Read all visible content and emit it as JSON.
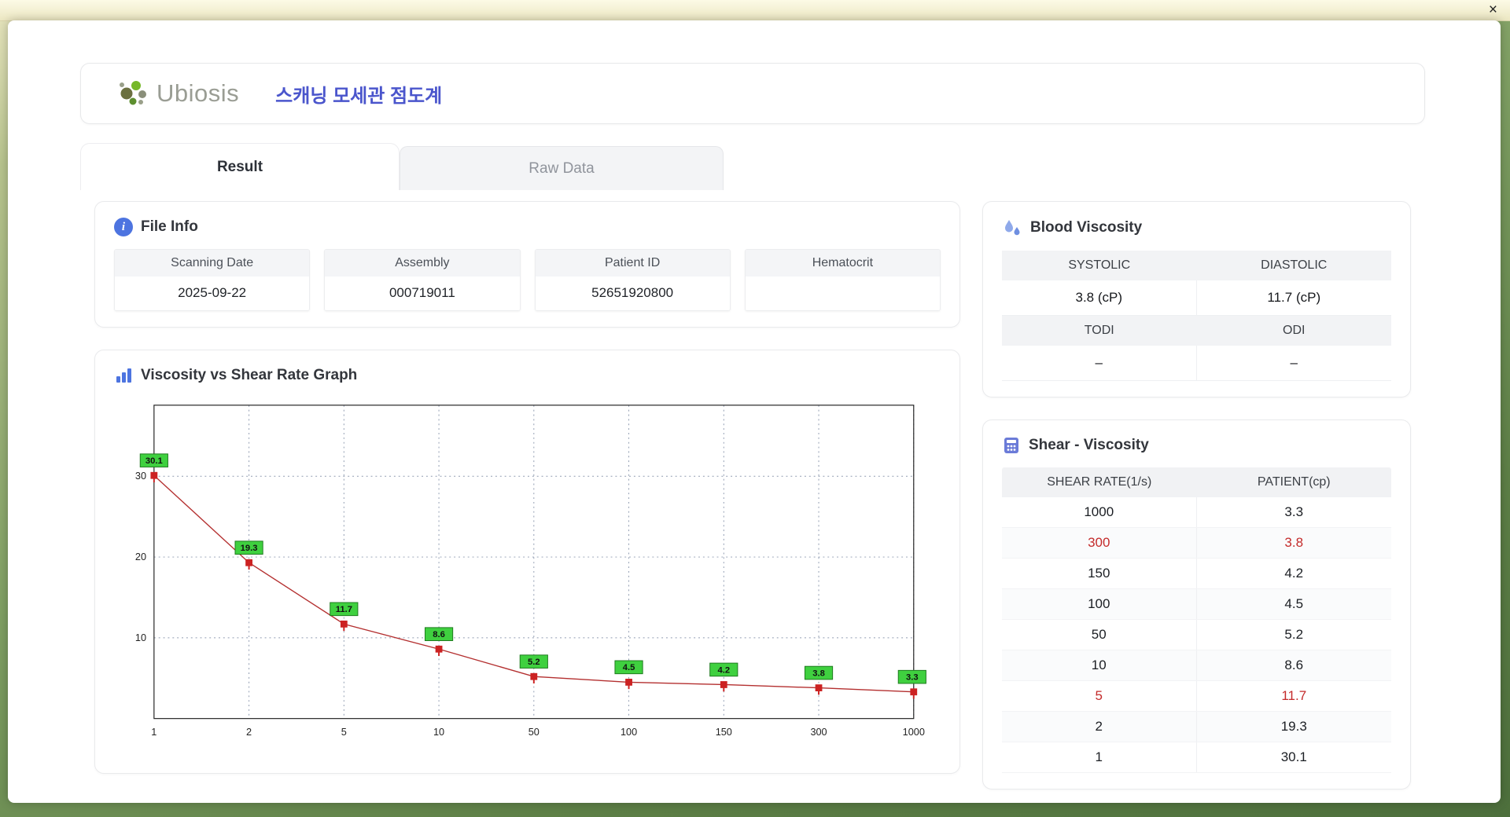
{
  "window": {
    "close_label": "×"
  },
  "header": {
    "brand": "Ubiosis",
    "title": "스캐닝 모세관 점도계"
  },
  "tabs": [
    {
      "label": "Result",
      "active": true
    },
    {
      "label": "Raw Data",
      "active": false
    }
  ],
  "file_info": {
    "title": "File Info",
    "fields": [
      {
        "label": "Scanning Date",
        "value": "2025-09-22"
      },
      {
        "label": "Assembly",
        "value": "000719011"
      },
      {
        "label": "Patient ID",
        "value": "52651920800"
      },
      {
        "label": "Hematocrit",
        "value": ""
      }
    ]
  },
  "blood_viscosity": {
    "title": "Blood Viscosity",
    "cells": [
      {
        "label": "SYSTOLIC",
        "value": "3.8 (cP)"
      },
      {
        "label": "DIASTOLIC",
        "value": "11.7 (cP)"
      },
      {
        "label": "TODI",
        "value": "–"
      },
      {
        "label": "ODI",
        "value": "–"
      }
    ]
  },
  "graph": {
    "title": "Viscosity vs Shear Rate Graph"
  },
  "chart_data": {
    "type": "line",
    "title": "Viscosity vs Shear Rate Graph",
    "x": [
      1,
      2,
      5,
      10,
      50,
      100,
      150,
      300,
      1000
    ],
    "values": [
      30.1,
      19.3,
      11.7,
      8.6,
      5.2,
      4.5,
      4.2,
      3.8,
      3.3
    ],
    "xlabel": "",
    "ylabel": "",
    "yticks": [
      10,
      20,
      30
    ],
    "ylim": [
      0,
      38.8
    ],
    "x_axis_style": "categorical-even-spacing",
    "grid": true,
    "line_color": "#b43030",
    "marker_color": "#cc2222",
    "label_bg": "#3fd03f",
    "label_border": "#1d7a1d",
    "grid_color": "#8f9bb0"
  },
  "shear_table": {
    "title": "Shear - Viscosity",
    "columns": [
      "SHEAR RATE(1/s)",
      "PATIENT(cp)"
    ],
    "rows": [
      {
        "shear": "1000",
        "patient": "3.3",
        "highlight": false
      },
      {
        "shear": "300",
        "patient": "3.8",
        "highlight": true
      },
      {
        "shear": "150",
        "patient": "4.2",
        "highlight": false
      },
      {
        "shear": "100",
        "patient": "4.5",
        "highlight": false
      },
      {
        "shear": "50",
        "patient": "5.2",
        "highlight": false
      },
      {
        "shear": "10",
        "patient": "8.6",
        "highlight": false
      },
      {
        "shear": "5",
        "patient": "11.7",
        "highlight": true
      },
      {
        "shear": "2",
        "patient": "19.3",
        "highlight": false
      },
      {
        "shear": "1",
        "patient": "30.1",
        "highlight": false
      }
    ]
  }
}
